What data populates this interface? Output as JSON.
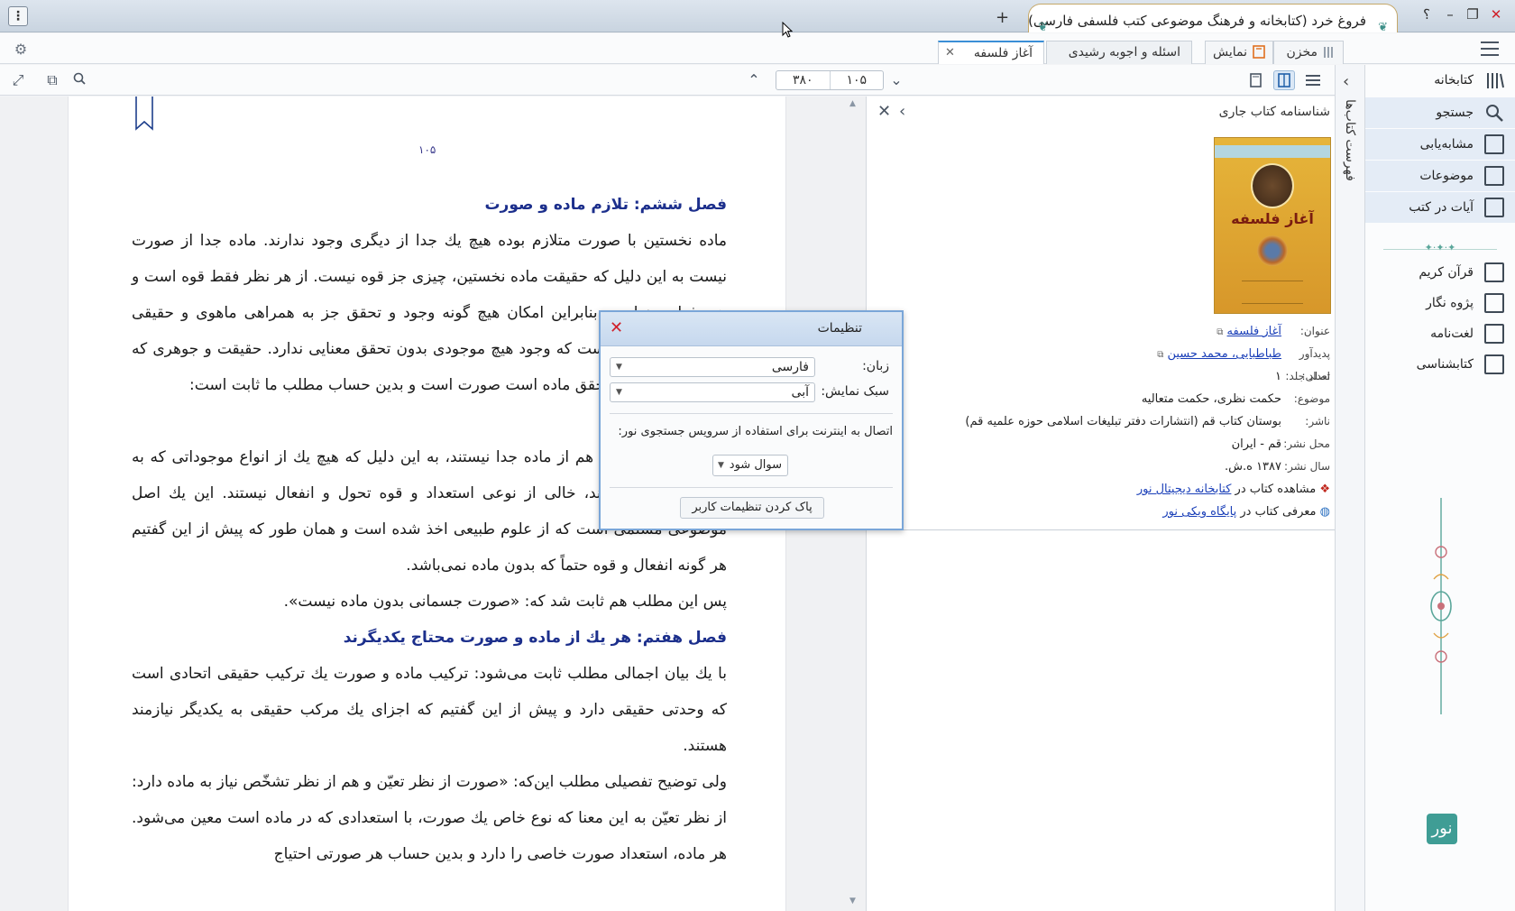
{
  "window": {
    "title": "فروغ خرد (کتابخانه و فرهنگ موضوعی کتب فلسفی فارسی)",
    "new_tab": "+",
    "help": "؟",
    "minimize": "–",
    "maximize": "❐",
    "close": "✕"
  },
  "tabs": {
    "active_tab": "آغاز فلسفه",
    "second_tab": "اسئله و اجوبه رشیدی",
    "show_label": "نمایش",
    "storage_label": "مخزن"
  },
  "toolbar": {
    "total_pages": "۳۸۰",
    "current_page": "۱۰۵"
  },
  "reader": {
    "page_number": "۱۰۵",
    "h1": "فصل ششم: تلازم ماده و صورت",
    "p1": "ماده نخستین با صورت متلازم بوده هیچ یك جدا از دیگری وجود ندارند. ماده جدا از صورت نیست به این دلیل که حقیقت ماده نخستین، چیزی جز قوه نیست. از هر نظر فقط قوه است و هیچ فعلیت ندارد و بنابراین امکان هیچ گونه وجود و تحقق جز به همراهی ماهوی و حقیقی ندارد، چون بدیهی است که وجود هیچ موجودی بدون تحقق معنایی ندارد. حقیقت و جوهری که فعلیت دارد و مایهٔ تحقق ماده است صورت است و بدین حساب مطلب ما ثابت است:",
    "p2": "ماده بدون صورت.",
    "p3": "صورت‌های جسمانی هم از ماده جدا نیستند، به این دلیل که هیچ یك از انواع موجوداتی که به حسّ و تجربه می‌آیند، خالی از نوعی استعداد و قوه تحول و انفعال نیستند. این یك اصل موضوعی مسلمی است که از علوم طبیعی اخذ شده است و همان طور که پیش از این گفتیم هر گونه انفعال و قوه حتماً که بدون ماده نمی‌باشد.",
    "p4": "پس این مطلب هم ثابت شد که: «صورت جسمانی بدون ماده نیست».",
    "h2": "فصل هفتم: هر یك از ماده و صورت محتاج یکدیگرند",
    "p5": "با یك بیان اجمالی مطلب ثابت می‌شود: ترکیب ماده و صورت یك ترکیب حقیقی اتحادی است که وحدتی حقیقی دارد و پیش از این گفتیم که اجزای یك مرکب حقیقی به یکدیگر نیازمند هستند.",
    "p6": "ولی توضیح تفصیلی مطلب این‌که: «صورت از نظر تعیّن و هم از نظر تشخّص نیاز به ماده دارد: از نظر تعیّن به این معنا که نوع خاص یك صورت، با استعدادی که در ماده است معین می‌شود. هر ماده، استعداد صورت خاصی را دارد و بدین حساب هر صورتی احتیاج"
  },
  "info": {
    "header": "شناسنامه کتاب جاری",
    "cover_title": "آغاز فلسفه",
    "rows": [
      {
        "label": "عنوان:",
        "value": "آغاز فلسفه"
      },
      {
        "label": "پدیدآور اصلی:",
        "value": "طباطبایی، محمد حسین"
      },
      {
        "label": "تعداد جلد:",
        "value": "۱"
      },
      {
        "label": "موضوع:",
        "value": "حکمت نظری، حکمت متعالیه"
      },
      {
        "label": "ناشر:",
        "value": "بوستان کتاب قم (انتشارات دفتر تبلیغات اسلامی حوزه علمیه قم)"
      },
      {
        "label": "محل نشر:",
        "value": "قم - ایران"
      },
      {
        "label": "سال نشر:",
        "value": "۱۳۸۷ ه.ش."
      }
    ],
    "digital_prefix": "مشاهده کتاب در",
    "digital_link": "کتابخانه دیجیتال نور",
    "wiki_prefix": "معرفی کتاب در",
    "wiki_link": "پایگاه ویکی نور"
  },
  "strip": {
    "label": "فهرست کتاب‌ها"
  },
  "nav": {
    "library": "کتابخانه",
    "search": "جستجو",
    "similar": "مشابه‌یابی",
    "topics": "موضوعات",
    "verses": "آیات در کتب",
    "quran": "قرآن کریم",
    "researcher": "پژوه نگار",
    "dictionary": "لغت‌نامه",
    "bibliography": "کتابشناسی",
    "logo": "نور"
  },
  "dialog": {
    "title": "تنظیمات",
    "language_label": "زبان:",
    "language_value": "فارسی",
    "style_label": "سبک نمایش:",
    "style_value": "آبی",
    "internet_note": "اتصال به اینترنت برای استفاده از سرویس جستجوی نور:",
    "internet_value": "سوال شود",
    "reset_button": "پاک کردن تنظیمات کاربر"
  },
  "colors": {
    "heading": "#1c2f8c",
    "link": "#1a3fb8",
    "accent": "#3b8fd6",
    "brand": "#3f9d95",
    "close": "#d0202a"
  }
}
